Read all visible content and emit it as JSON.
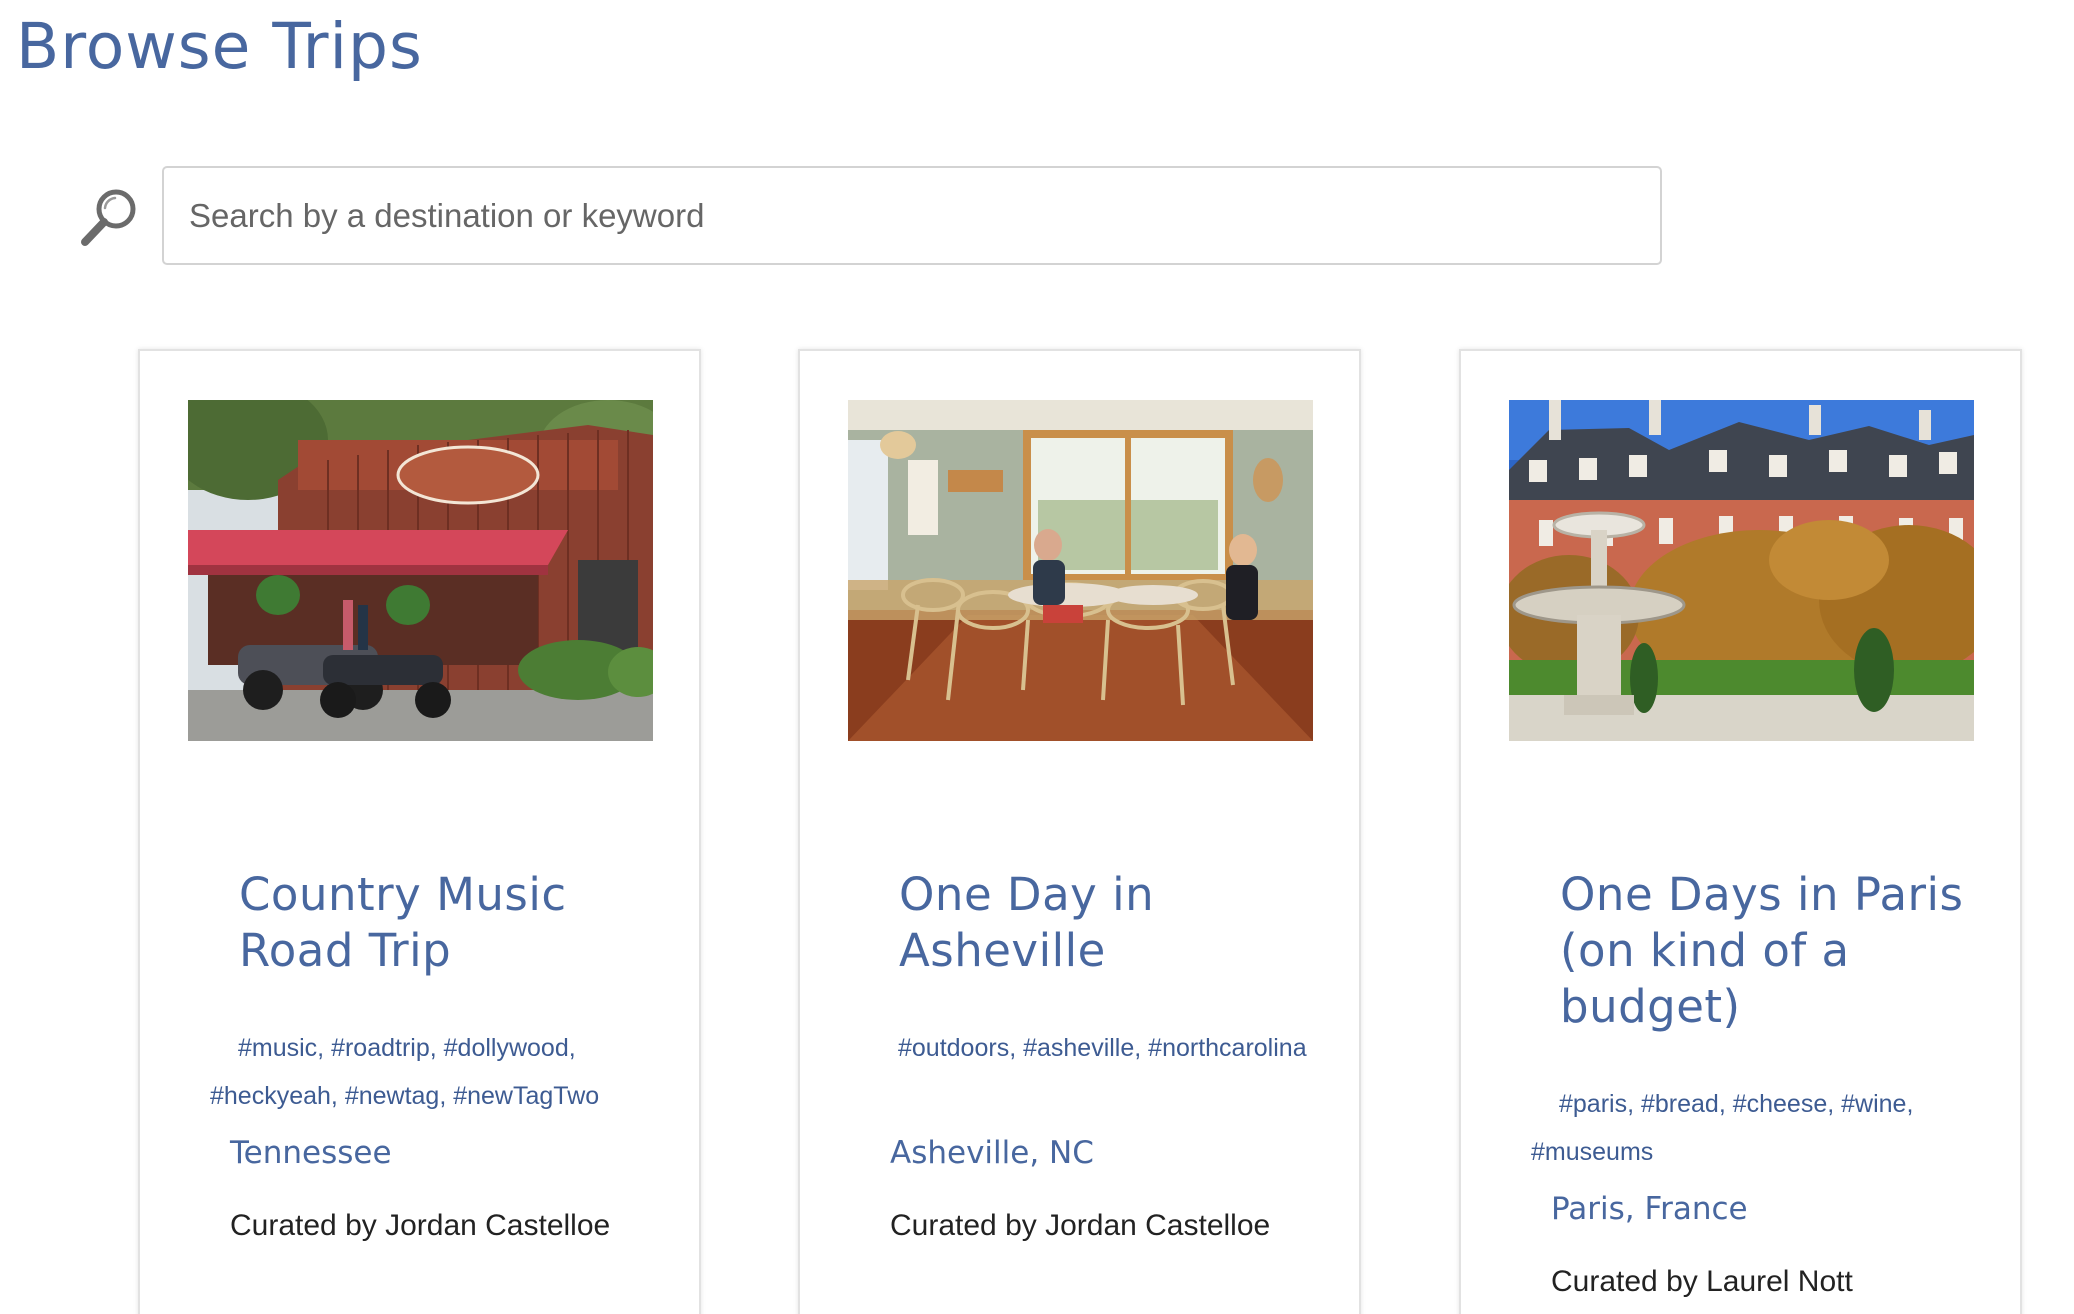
{
  "page": {
    "title": "Browse Trips"
  },
  "search": {
    "placeholder": "Search by a destination or keyword",
    "value": ""
  },
  "icons": {
    "search": "search-icon"
  },
  "colors": {
    "accent": "#48679f",
    "tag": "#3d5b92",
    "text": "#222222",
    "border": "#d3d3d3"
  },
  "trips": [
    {
      "title": "Country Music Road Trip",
      "tags": "#music, #roadtrip, #dollywood, #heckyeah, #newtag, #newTagTwo",
      "location": "Tennessee",
      "curator": "Curated by Jordan Castelloe",
      "image": "country-store-with-motorcycles-photo"
    },
    {
      "title": "One Day in Asheville",
      "tags": "#outdoors, #asheville, #northcarolina",
      "location": "Asheville, NC",
      "curator": "Curated by Jordan Castelloe",
      "image": "cafe-interior-with-two-people-photo"
    },
    {
      "title": "One Days in Paris (on kind of a budget)",
      "tags": "#paris, #bread, #cheese, #wine, #museums",
      "location": "Paris, France",
      "curator": "Curated by Laurel Nott",
      "image": "paris-square-with-fountain-photo"
    }
  ]
}
